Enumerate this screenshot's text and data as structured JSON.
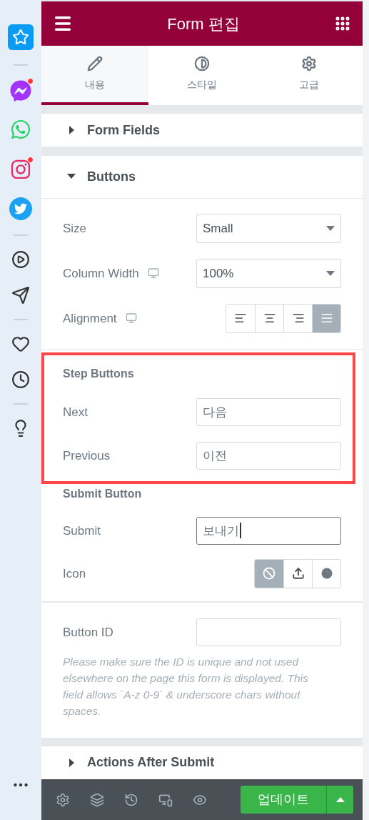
{
  "sidebar_items": [
    {
      "notification": false
    },
    {
      "notification": true
    },
    {
      "notification": false
    },
    {
      "notification": true
    },
    {
      "notification": false
    },
    {
      "notification": false
    },
    {
      "notification": false
    },
    {
      "notification": false
    },
    {
      "notification": false
    },
    {
      "notification": false
    },
    {
      "notification": false
    }
  ],
  "header": {
    "title": "Form 편집"
  },
  "tabs": [
    {
      "label": "내용",
      "selected": true
    },
    {
      "label": "스타일",
      "selected": false
    },
    {
      "label": "고급",
      "selected": false
    }
  ],
  "form_fields": {
    "title": "Form Fields",
    "expanded": false
  },
  "buttons_section": {
    "title": "Buttons",
    "expanded": true,
    "size": {
      "label": "Size",
      "value": "Small"
    },
    "column_width": {
      "label": "Column Width",
      "value": "100%"
    },
    "alignment": {
      "label": "Alignment",
      "options": [
        {
          "selected": false
        },
        {
          "selected": false
        },
        {
          "selected": false
        },
        {
          "selected": true
        }
      ]
    }
  },
  "step_buttons": {
    "title": "Step Buttons",
    "fields": [
      {
        "label": "Next",
        "value": "다음",
        "focused": false
      },
      {
        "label": "Previous",
        "value": "이전",
        "focused": false
      }
    ]
  },
  "submit_button": {
    "title": "Submit Button",
    "field": {
      "label": "Submit",
      "value": "보내기",
      "focused": true
    },
    "icon": {
      "label": "Icon",
      "options": [
        {
          "selected": true
        },
        {
          "selected": false
        },
        {
          "selected": false
        }
      ]
    }
  },
  "button_id": {
    "label": "Button ID",
    "help": "Please make sure the ID is unique and not used elsewhere on the page this form is displayed. This field allows `A-z 0-9` & underscore chars without spaces."
  },
  "actions_after_submit": {
    "title": "Actions After Submit",
    "expanded": false
  },
  "footer": {
    "update_label": "업데이트"
  }
}
